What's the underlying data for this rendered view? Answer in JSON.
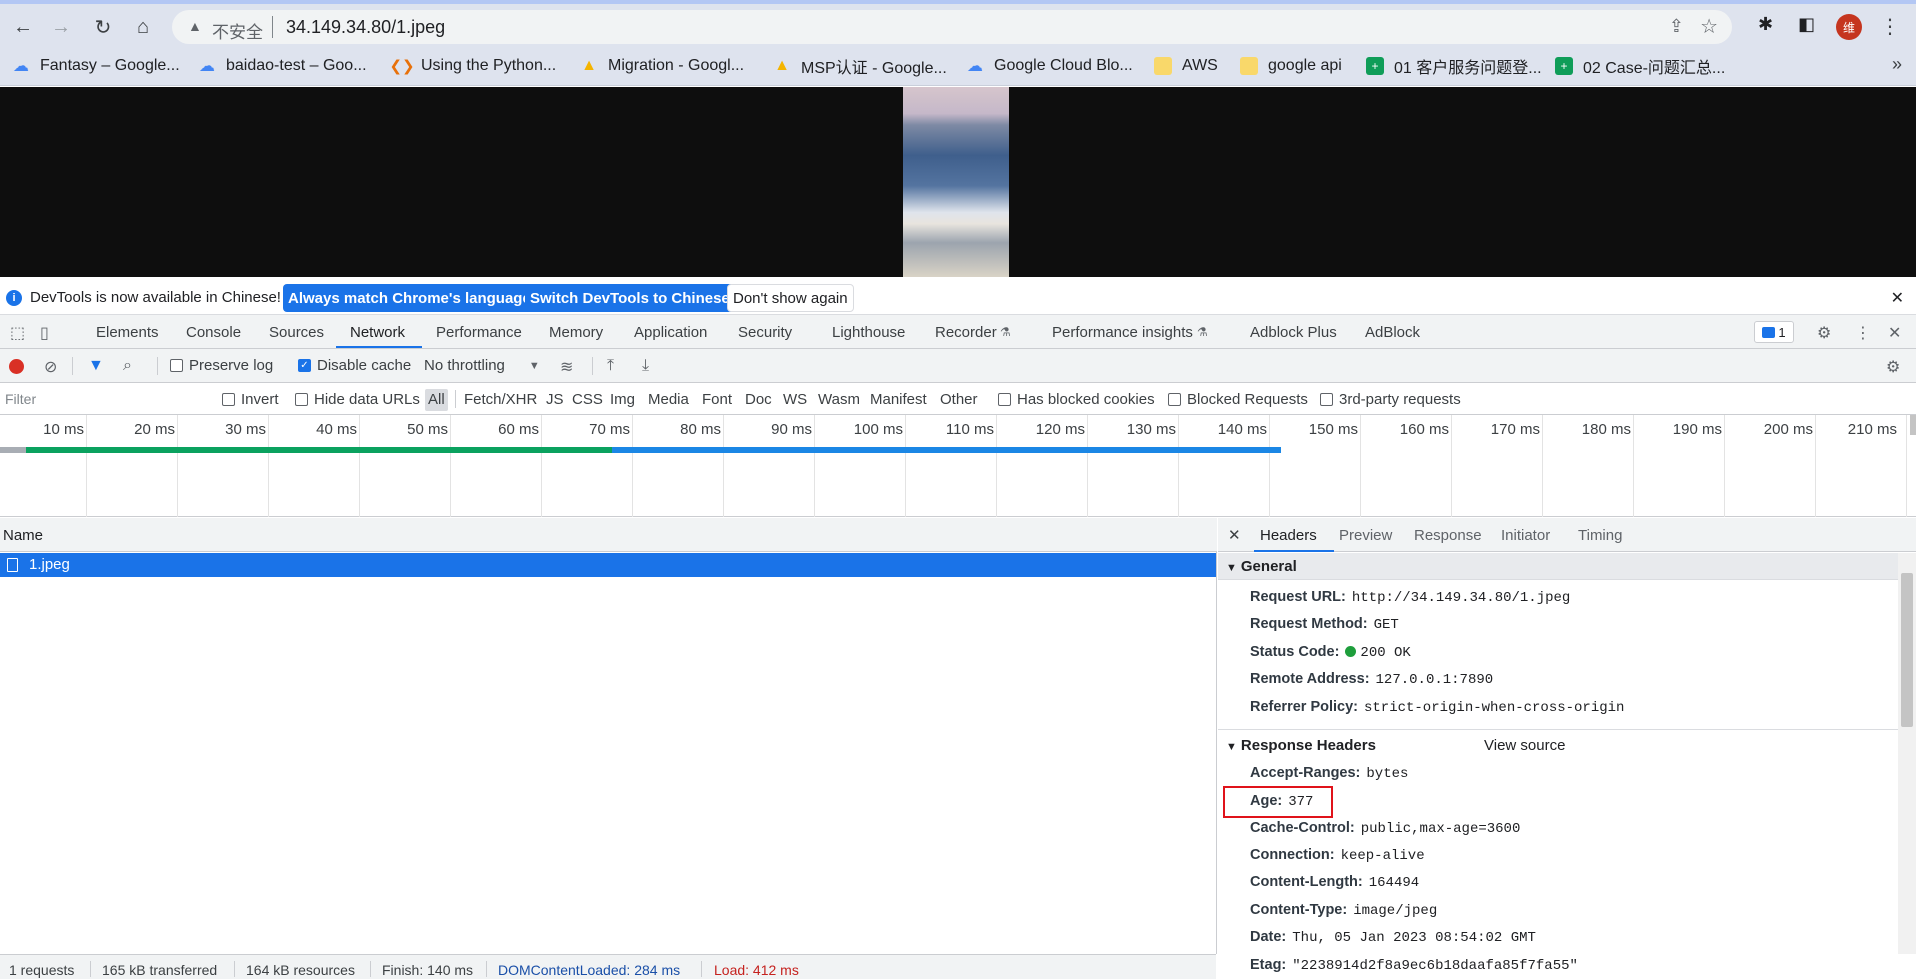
{
  "browser": {
    "security_label": "不安全",
    "url": "34.149.34.80/1.jpeg",
    "profile_initial": "维",
    "bookmarks": [
      {
        "label": "Fantasy – Google...",
        "icon": "cloud-icon"
      },
      {
        "label": "baidao-test – Goo...",
        "icon": "cloud-icon"
      },
      {
        "label": "Using the Python...",
        "icon": "colab-icon"
      },
      {
        "label": "Migration - Googl...",
        "icon": "drive-icon"
      },
      {
        "label": "MSP认证 - Google...",
        "icon": "drive-icon"
      },
      {
        "label": "Google Cloud Blo...",
        "icon": "cloud-icon"
      },
      {
        "label": "AWS",
        "icon": "folder-icon"
      },
      {
        "label": "google api",
        "icon": "folder-icon"
      },
      {
        "label": "01 客户服务问题登...",
        "icon": "sheets-icon"
      },
      {
        "label": "02 Case-问题汇总...",
        "icon": "sheets-icon"
      }
    ],
    "more_symbol": "»"
  },
  "infobar": {
    "message": "DevTools is now available in Chinese!",
    "btn_match": "Always match Chrome's language",
    "btn_switch": "Switch DevTools to Chinese",
    "btn_dismiss": "Don't show again"
  },
  "devtools_tabs": [
    "Elements",
    "Console",
    "Sources",
    "Network",
    "Performance",
    "Memory",
    "Application",
    "Security",
    "Lighthouse",
    "Recorder",
    "Performance insights",
    "Adblock Plus",
    "AdBlock"
  ],
  "active_tab": "Network",
  "issues_count": "1",
  "network_toolbar": {
    "preserve_log": "Preserve log",
    "disable_cache": "Disable cache",
    "throttling": "No throttling"
  },
  "filter_bar": {
    "placeholder": "Filter",
    "invert": "Invert",
    "hide_data_urls": "Hide data URLs",
    "types": [
      "All",
      "Fetch/XHR",
      "JS",
      "CSS",
      "Img",
      "Media",
      "Font",
      "Doc",
      "WS",
      "Wasm",
      "Manifest",
      "Other"
    ],
    "has_blocked_cookies": "Has blocked cookies",
    "blocked_requests": "Blocked Requests",
    "third_party": "3rd-party requests"
  },
  "timeline_ticks": [
    "10 ms",
    "20 ms",
    "30 ms",
    "40 ms",
    "50 ms",
    "60 ms",
    "70 ms",
    "80 ms",
    "90 ms",
    "100 ms",
    "110 ms",
    "120 ms",
    "130 ms",
    "140 ms",
    "150 ms",
    "160 ms",
    "170 ms",
    "180 ms",
    "190 ms",
    "200 ms",
    "210 ms"
  ],
  "request_list": {
    "column_name": "Name",
    "rows": [
      "1.jpeg"
    ]
  },
  "detail": {
    "tabs": [
      "Headers",
      "Preview",
      "Response",
      "Initiator",
      "Timing"
    ],
    "general_title": "General",
    "general": [
      {
        "k": "Request URL:",
        "v": "http://34.149.34.80/1.jpeg"
      },
      {
        "k": "Request Method:",
        "v": "GET"
      },
      {
        "k": "Status Code:",
        "v": "200 OK"
      },
      {
        "k": "Remote Address:",
        "v": "127.0.0.1:7890"
      },
      {
        "k": "Referrer Policy:",
        "v": "strict-origin-when-cross-origin"
      }
    ],
    "response_title": "Response Headers",
    "view_source": "View source",
    "response": [
      {
        "k": "Accept-Ranges:",
        "v": "bytes"
      },
      {
        "k": "Age:",
        "v": "377"
      },
      {
        "k": "Cache-Control:",
        "v": "public,max-age=3600"
      },
      {
        "k": "Connection:",
        "v": "keep-alive"
      },
      {
        "k": "Content-Length:",
        "v": "164494"
      },
      {
        "k": "Content-Type:",
        "v": "image/jpeg"
      },
      {
        "k": "Date:",
        "v": "Thu, 05 Jan 2023 08:54:02 GMT"
      },
      {
        "k": "Etag:",
        "v": "\"2238914d2f8a9ec6b18daafa85f7fa55\""
      }
    ]
  },
  "statusbar": {
    "requests": "1 requests",
    "transferred": "165 kB transferred",
    "resources": "164 kB resources",
    "finish": "Finish: 140 ms",
    "dcl": "DOMContentLoaded: 284 ms",
    "load": "Load: 412 ms"
  }
}
